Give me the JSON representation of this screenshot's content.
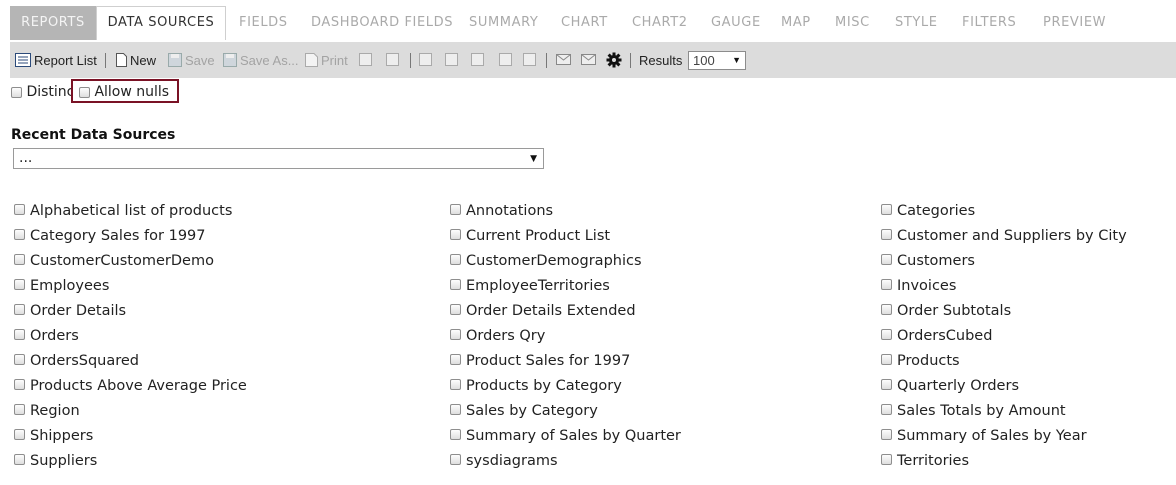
{
  "tabs": [
    {
      "label": "REPORTS"
    },
    {
      "label": "DATA SOURCES"
    },
    {
      "label": "FIELDS"
    },
    {
      "label": "DASHBOARD FIELDS"
    },
    {
      "label": "SUMMARY"
    },
    {
      "label": "CHART"
    },
    {
      "label": "CHART2"
    },
    {
      "label": "GAUGE"
    },
    {
      "label": "MAP"
    },
    {
      "label": "MISC"
    },
    {
      "label": "STYLE"
    },
    {
      "label": "FILTERS"
    },
    {
      "label": "PREVIEW"
    }
  ],
  "toolbar": {
    "report_list": "Report List",
    "new": "New",
    "save": "Save",
    "save_as": "Save As...",
    "print": "Print",
    "results_label": "Results",
    "results_value": "100"
  },
  "options": {
    "distinct": "Distinct",
    "allow_nulls": "Allow nulls"
  },
  "recent": {
    "title": "Recent Data Sources",
    "selected": "..."
  },
  "data_sources": [
    [
      "Alphabetical list of products",
      "Category Sales for 1997",
      "CustomerCustomerDemo",
      "Employees",
      "Order Details",
      "Orders",
      "OrdersSquared",
      "Products Above Average Price",
      "Region",
      "Shippers",
      "Suppliers"
    ],
    [
      "Annotations",
      "Current Product List",
      "CustomerDemographics",
      "EmployeeTerritories",
      "Order Details Extended",
      "Orders Qry",
      "Product Sales for 1997",
      "Products by Category",
      "Sales by Category",
      "Summary of Sales by Quarter",
      "sysdiagrams"
    ],
    [
      "Categories",
      "Customer and Suppliers by City",
      "Customers",
      "Invoices",
      "Order Subtotals",
      "OrdersCubed",
      "Products",
      "Quarterly Orders",
      "Sales Totals by Amount",
      "Summary of Sales by Year",
      "Territories"
    ]
  ]
}
